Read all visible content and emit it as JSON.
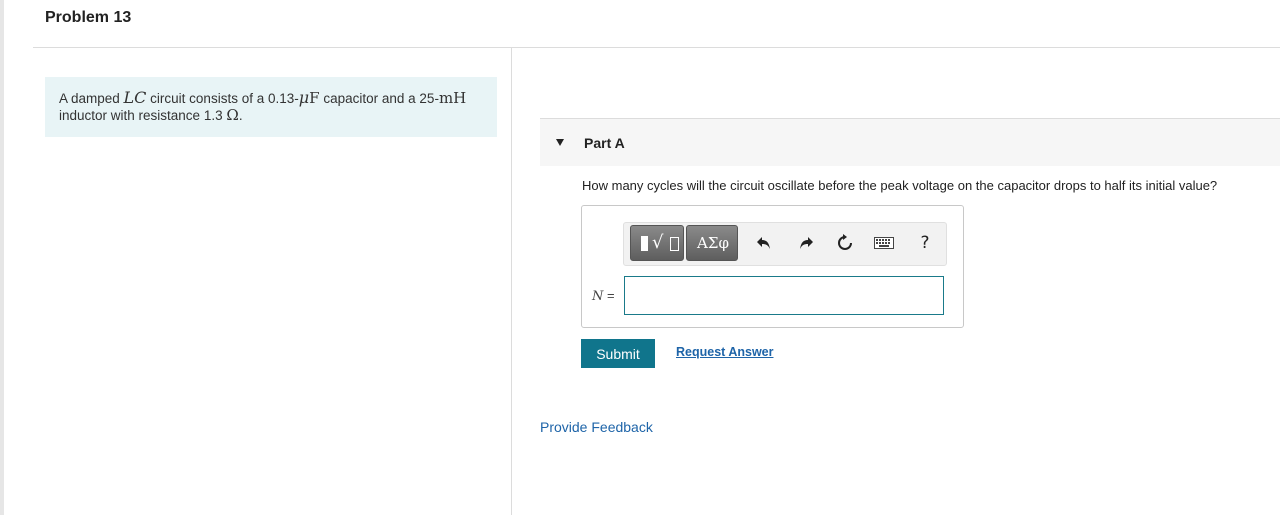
{
  "problem": {
    "title": "Problem 13",
    "statement": {
      "t1": "A damped ",
      "lc": "LC",
      "t2": " circuit consists of a ",
      "cap_value": "0.13",
      "dash1": "-",
      "mu": "μ",
      "farad": "F",
      "t3": " capacitor and a ",
      "ind_value": "25",
      "dash2": "-",
      "mh": "mH",
      "t4": "inductor with resistance ",
      "res_value": "1.3",
      "ohm": "Ω",
      "period": "."
    }
  },
  "part": {
    "label": "Part A",
    "question": "How many cycles will the circuit oscillate before the peak voltage on the capacitor drops to half its initial value?",
    "toolbar": {
      "template_root_glyph": "√",
      "greek_label": "ΑΣφ",
      "help_label": "?"
    },
    "variable": "N",
    "equals": " =",
    "answer_value": "",
    "submit_label": "Submit",
    "request_answer_label": "Request Answer"
  },
  "feedback_label": "Provide Feedback",
  "colors": {
    "accent": "#10758c",
    "link": "#1e64a8",
    "problem_bg": "#e8f4f6"
  }
}
